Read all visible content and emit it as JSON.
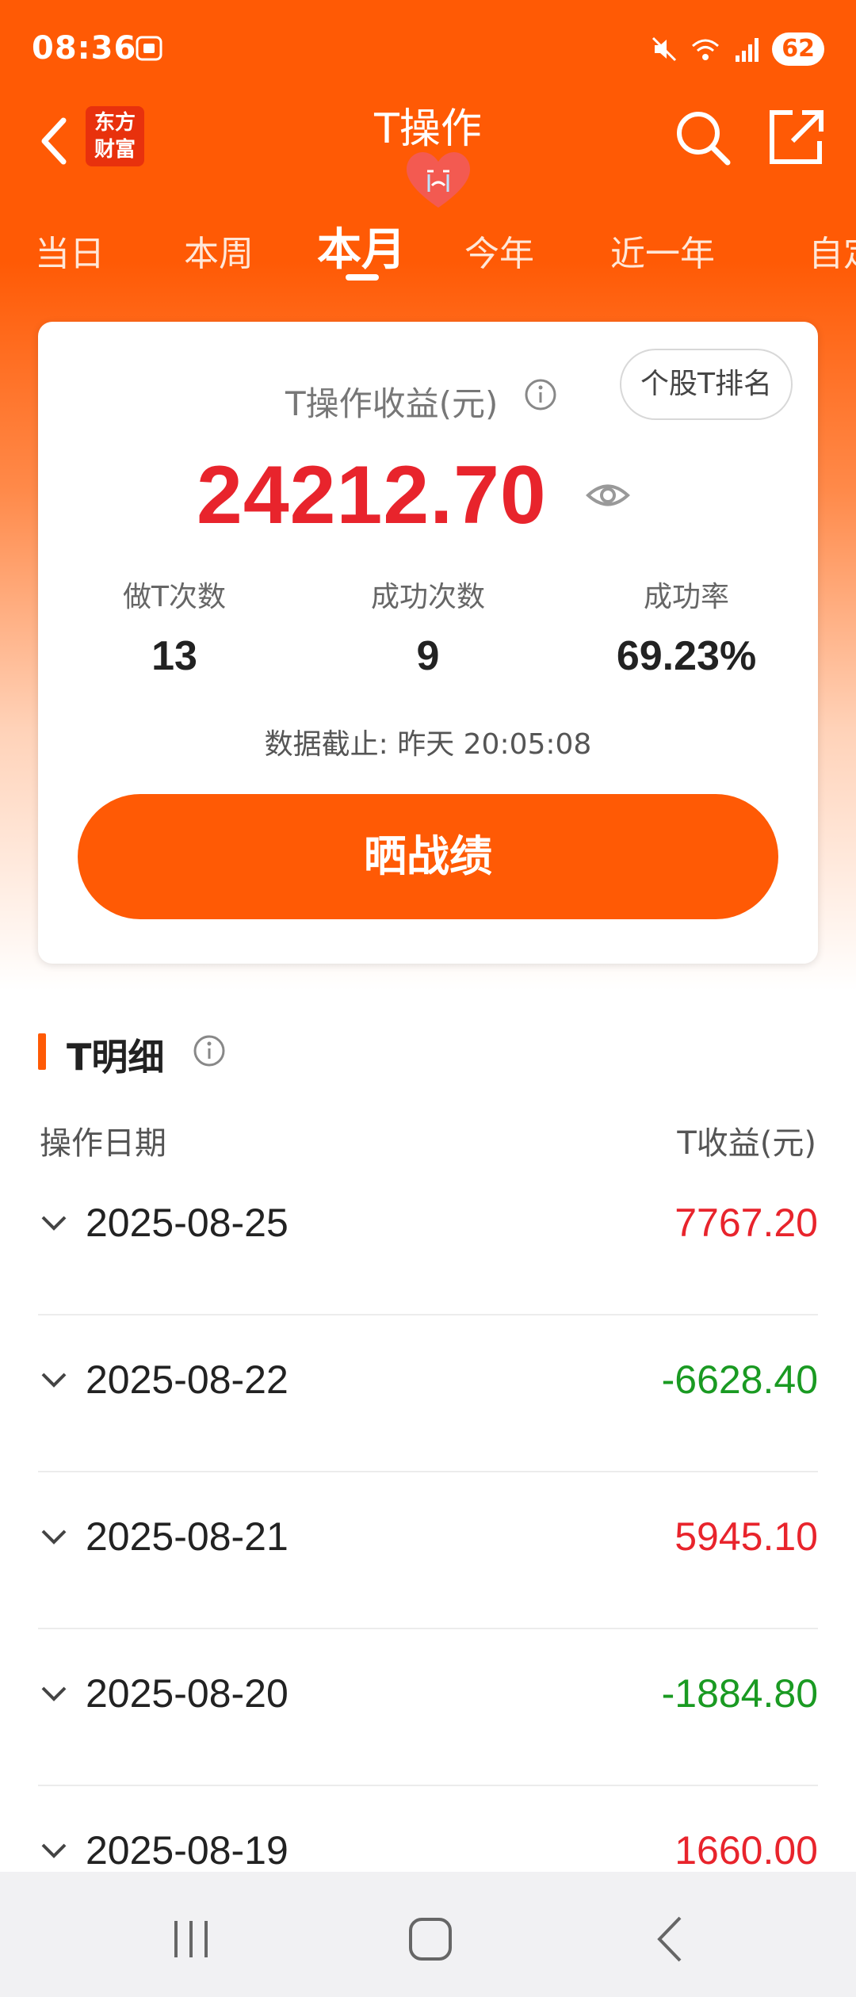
{
  "status_bar": {
    "time": "08:36",
    "battery": "62"
  },
  "header": {
    "title": "T操作",
    "logo_line1": "东方",
    "logo_line2": "财富"
  },
  "tabs": [
    {
      "label": "当日",
      "active": false
    },
    {
      "label": "本周",
      "active": false
    },
    {
      "label": "本月",
      "active": true
    },
    {
      "label": "今年",
      "active": false
    },
    {
      "label": "近一年",
      "active": false
    },
    {
      "label": "自定",
      "active": false
    }
  ],
  "summary": {
    "title": "T操作收益(元)",
    "rank_button": "个股T排名",
    "profit": "24212.70",
    "stats": [
      {
        "label": "做T次数",
        "value": "13"
      },
      {
        "label": "成功次数",
        "value": "9"
      },
      {
        "label": "成功率",
        "value": "69.23%"
      }
    ],
    "data_time": "数据截止: 昨天 20:05:08",
    "share_button": "晒战绩"
  },
  "detail": {
    "section_title": "T明细",
    "col_date": "操作日期",
    "col_profit": "T收益(元)",
    "rows": [
      {
        "date": "2025-08-25",
        "value": "7767.20",
        "sign": "pos"
      },
      {
        "date": "2025-08-22",
        "value": "-6628.40",
        "sign": "neg"
      },
      {
        "date": "2025-08-21",
        "value": "5945.10",
        "sign": "pos"
      },
      {
        "date": "2025-08-20",
        "value": "-1884.80",
        "sign": "neg"
      },
      {
        "date": "2025-08-19",
        "value": "1660.00",
        "sign": "pos"
      }
    ]
  },
  "colors": {
    "brand": "#ff5a05",
    "positive": "#e8242c",
    "negative": "#1a9a22"
  }
}
